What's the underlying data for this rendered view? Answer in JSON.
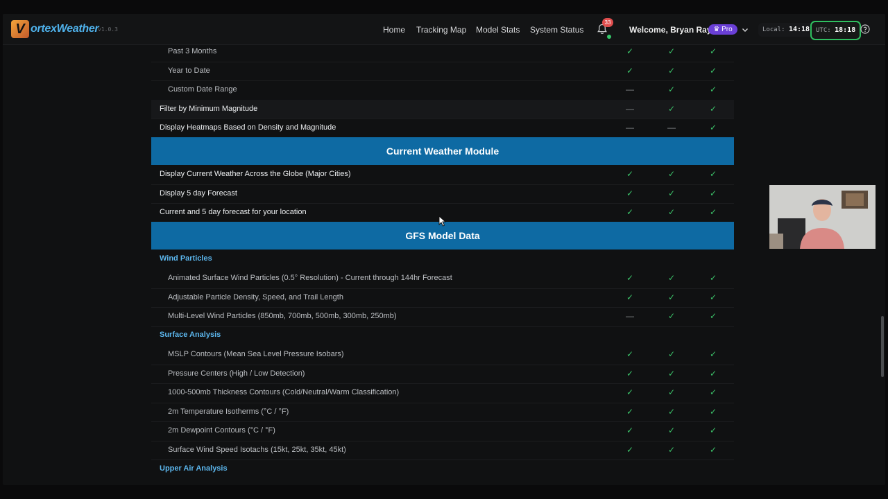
{
  "header": {
    "logo_v": "V",
    "logo_text": "ortexWeather",
    "version": "v1.0.3",
    "nav": [
      "Home",
      "Tracking Map",
      "Model Stats",
      "System Status"
    ],
    "notifications_count": "33",
    "welcome": "Welcome, Bryan Ray!",
    "plan_badge": "♛ Pro",
    "local_label": "Local:",
    "local_time": "14:18",
    "utc_label": "UTC:",
    "utc_time": "18:18"
  },
  "rows_top": [
    {
      "label": "Past 3 Months",
      "level": "sub",
      "cols": [
        "✓",
        "✓",
        "✓"
      ]
    },
    {
      "label": "Year to Date",
      "level": "sub",
      "cols": [
        "✓",
        "✓",
        "✓"
      ]
    },
    {
      "label": "Custom Date Range",
      "level": "sub",
      "cols": [
        "—",
        "✓",
        "✓"
      ]
    },
    {
      "label": "Filter by Minimum Magnitude",
      "level": "main",
      "cols": [
        "—",
        "✓",
        "✓"
      ]
    },
    {
      "label": "Display Heatmaps Based on Density and Magnitude",
      "level": "main",
      "cols": [
        "—",
        "—",
        "✓"
      ]
    }
  ],
  "section_current": "Current Weather Module",
  "rows_current": [
    {
      "label": "Display Current Weather Across the Globe (Major Cities)",
      "level": "main",
      "cols": [
        "✓",
        "✓",
        "✓"
      ]
    },
    {
      "label": "Display 5 day Forecast",
      "level": "main",
      "cols": [
        "✓",
        "✓",
        "✓"
      ]
    },
    {
      "label": "Current and 5 day forecast for your location",
      "level": "main",
      "cols": [
        "✓",
        "✓",
        "✓"
      ]
    }
  ],
  "section_gfs": "GFS Model Data",
  "category_wind": "Wind Particles",
  "rows_wind": [
    {
      "label": "Animated Surface Wind Particles (0.5° Resolution) - Current through 144hr Forecast",
      "level": "sub",
      "cols": [
        "✓",
        "✓",
        "✓"
      ]
    },
    {
      "label": "Adjustable Particle Density, Speed, and Trail Length",
      "level": "sub",
      "cols": [
        "✓",
        "✓",
        "✓"
      ]
    },
    {
      "label": "Multi-Level Wind Particles (850mb, 700mb, 500mb, 300mb, 250mb)",
      "level": "sub",
      "cols": [
        "—",
        "✓",
        "✓"
      ]
    }
  ],
  "category_surface": "Surface Analysis",
  "rows_surface": [
    {
      "label": "MSLP Contours (Mean Sea Level Pressure Isobars)",
      "level": "sub",
      "cols": [
        "✓",
        "✓",
        "✓"
      ]
    },
    {
      "label": "Pressure Centers (High / Low Detection)",
      "level": "sub",
      "cols": [
        "✓",
        "✓",
        "✓"
      ]
    },
    {
      "label": "1000-500mb Thickness Contours (Cold/Neutral/Warm Classification)",
      "level": "sub",
      "cols": [
        "✓",
        "✓",
        "✓"
      ]
    },
    {
      "label": "2m Temperature Isotherms (°C / °F)",
      "level": "sub",
      "cols": [
        "✓",
        "✓",
        "✓"
      ]
    },
    {
      "label": "2m Dewpoint Contours (°C / °F)",
      "level": "sub",
      "cols": [
        "✓",
        "✓",
        "✓"
      ]
    },
    {
      "label": "Surface Wind Speed Isotachs (15kt, 25kt, 35kt, 45kt)",
      "level": "sub",
      "cols": [
        "✓",
        "✓",
        "✓"
      ]
    }
  ],
  "category_upper": "Upper Air Analysis",
  "colors": {
    "accent": "#0e6aa3",
    "check": "#3cc46a",
    "category": "#5cb7ee"
  }
}
